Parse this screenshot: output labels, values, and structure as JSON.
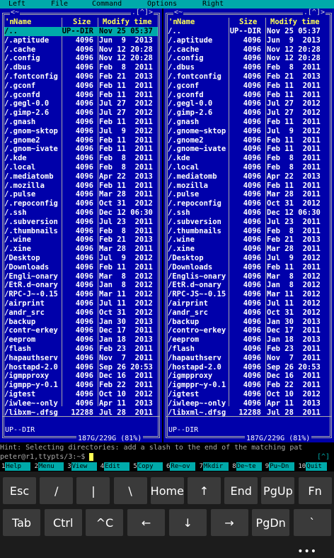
{
  "menu": {
    "left": "Left",
    "file": "File",
    "command": "Command",
    "options": "Options",
    "right": "Right"
  },
  "panel_left": {
    "top_left": "<~",
    "top_right": ".[^]>",
    "header": {
      "n": "'n",
      "name": "Name",
      "size": "Size",
      "time": "Modify time"
    },
    "rows": [
      {
        "name": "/..",
        "size": "UP--DIR",
        "time": "Nov 25 05:37",
        "sel": true
      },
      {
        "name": "/.aptitude",
        "size": "4096",
        "time": "Jun  9  2013"
      },
      {
        "name": "/.cache",
        "size": "4096",
        "time": "Nov 12 20:28"
      },
      {
        "name": "/.config",
        "size": "4096",
        "time": "Nov 12 20:28"
      },
      {
        "name": "/.dbus",
        "size": "4096",
        "time": "Feb  8  2011"
      },
      {
        "name": "/.fontconfig",
        "size": "4096",
        "time": "Feb 21  2013"
      },
      {
        "name": "/.gconf",
        "size": "4096",
        "time": "Feb 11  2011"
      },
      {
        "name": "/.gconfd",
        "size": "4096",
        "time": "Feb 11  2011"
      },
      {
        "name": "/.gegl-0.0",
        "size": "4096",
        "time": "Jul 27  2012"
      },
      {
        "name": "/.gimp-2.6",
        "size": "4096",
        "time": "Jul 27  2012"
      },
      {
        "name": "/.gnash",
        "size": "4096",
        "time": "Feb 11  2011"
      },
      {
        "name": "/.gnom~sktop",
        "size": "4096",
        "time": "Jul  9  2012"
      },
      {
        "name": "/.gnome2",
        "size": "4096",
        "time": "Feb 11  2011"
      },
      {
        "name": "/.gnom~ivate",
        "size": "4096",
        "time": "Feb 11  2011"
      },
      {
        "name": "/.kde",
        "size": "4096",
        "time": "Feb  8  2011"
      },
      {
        "name": "/.local",
        "size": "4096",
        "time": "Feb  8  2011"
      },
      {
        "name": "/.mediatomb",
        "size": "4096",
        "time": "Apr 22  2013"
      },
      {
        "name": "/.mozilla",
        "size": "4096",
        "time": "Feb 11  2011"
      },
      {
        "name": "/.pulse",
        "size": "4096",
        "time": "Mar 28  2011"
      },
      {
        "name": "/.repoconfig",
        "size": "4096",
        "time": "Oct 31  2012"
      },
      {
        "name": "/.ssh",
        "size": "4096",
        "time": "Dec 12 06:30"
      },
      {
        "name": "/.subversion",
        "size": "4096",
        "time": "Jul 23  2011"
      },
      {
        "name": "/.thumbnails",
        "size": "4096",
        "time": "Feb  8  2011"
      },
      {
        "name": "/.wine",
        "size": "4096",
        "time": "Feb 21  2013"
      },
      {
        "name": "/.xine",
        "size": "4096",
        "time": "Mar 28  2011"
      },
      {
        "name": "/Desktop",
        "size": "4096",
        "time": "Jul  9  2012"
      },
      {
        "name": "/Downloads",
        "size": "4096",
        "time": "Feb 11  2011"
      },
      {
        "name": "/Engli~onary",
        "size": "4096",
        "time": "Mar  8  2012"
      },
      {
        "name": "/EtR.d~onary",
        "size": "4096",
        "time": "Jan  8  2012"
      },
      {
        "name": "/RPC-J~-0.15",
        "size": "4096",
        "time": "Mar 11  2012"
      },
      {
        "name": "/airprint",
        "size": "4096",
        "time": "Jul 11  2012"
      },
      {
        "name": "/andr_src",
        "size": "4096",
        "time": "Oct 31  2012"
      },
      {
        "name": "/backup",
        "size": "4096",
        "time": "Jan 30  2013"
      },
      {
        "name": "/contr~erkey",
        "size": "4096",
        "time": "Dec 17  2011"
      },
      {
        "name": "/eeprom",
        "size": "4096",
        "time": "Jan 18  2013"
      },
      {
        "name": "/flash",
        "size": "4096",
        "time": "Feb 23  2011"
      },
      {
        "name": "/hapauthserv",
        "size": "4096",
        "time": "Nov  7  2011"
      },
      {
        "name": "/hostapd-2.0",
        "size": "4096",
        "time": "Sep 26 20:53"
      },
      {
        "name": "/igmpproxy",
        "size": "4096",
        "time": "Dec 16  2011"
      },
      {
        "name": "/igmpp~y-0.1",
        "size": "4096",
        "time": "Feb 22  2011"
      },
      {
        "name": "/igtest",
        "size": "4096",
        "time": "Oct 10  2012"
      },
      {
        "name": "/iwlee~-only",
        "size": "4096",
        "time": "Apr 11  2013"
      },
      {
        "name": "/libxm~.dfsg",
        "size": "12288",
        "time": "Jul 28  2011"
      }
    ],
    "mini": "UP--DIR",
    "total": "187G/229G (81%)"
  },
  "panel_right": {
    "top_left": "<~",
    "top_right": ".[^]>",
    "header": {
      "n": "'n",
      "name": "Name",
      "size": "Size",
      "time": "Modify time"
    },
    "rows": [
      {
        "name": "/..",
        "size": "UP--DIR",
        "time": "Nov 25 05:37"
      },
      {
        "name": "/.aptitude",
        "size": "4096",
        "time": "Jun  9  2013"
      },
      {
        "name": "/.cache",
        "size": "4096",
        "time": "Nov 12 20:28"
      },
      {
        "name": "/.config",
        "size": "4096",
        "time": "Nov 12 20:28"
      },
      {
        "name": "/.dbus",
        "size": "4096",
        "time": "Feb  8  2011"
      },
      {
        "name": "/.fontconfig",
        "size": "4096",
        "time": "Feb 21  2013"
      },
      {
        "name": "/.gconf",
        "size": "4096",
        "time": "Feb 11  2011"
      },
      {
        "name": "/.gconfd",
        "size": "4096",
        "time": "Feb 11  2011"
      },
      {
        "name": "/.gegl-0.0",
        "size": "4096",
        "time": "Jul 27  2012"
      },
      {
        "name": "/.gimp-2.6",
        "size": "4096",
        "time": "Jul 27  2012"
      },
      {
        "name": "/.gnash",
        "size": "4096",
        "time": "Feb 11  2011"
      },
      {
        "name": "/.gnome~sktop",
        "size": "4096",
        "time": "Jul  9  2012"
      },
      {
        "name": "/.gnome2",
        "size": "4096",
        "time": "Feb 11  2011"
      },
      {
        "name": "/.gnome~ivate",
        "size": "4096",
        "time": "Feb 11  2011"
      },
      {
        "name": "/.kde",
        "size": "4096",
        "time": "Feb  8  2011"
      },
      {
        "name": "/.local",
        "size": "4096",
        "time": "Feb  8  2011"
      },
      {
        "name": "/.mediatomb",
        "size": "4096",
        "time": "Apr 22  2013"
      },
      {
        "name": "/.mozilla",
        "size": "4096",
        "time": "Feb 11  2011"
      },
      {
        "name": "/.pulse",
        "size": "4096",
        "time": "Mar 28  2011"
      },
      {
        "name": "/.repoconfig",
        "size": "4096",
        "time": "Oct 31  2012"
      },
      {
        "name": "/.ssh",
        "size": "4096",
        "time": "Dec 12 06:30"
      },
      {
        "name": "/.subversion",
        "size": "4096",
        "time": "Jul 23  2011"
      },
      {
        "name": "/.thumbnails",
        "size": "4096",
        "time": "Feb  8  2011"
      },
      {
        "name": "/.wine",
        "size": "4096",
        "time": "Feb 21  2013"
      },
      {
        "name": "/.xine",
        "size": "4096",
        "time": "Mar 28  2011"
      },
      {
        "name": "/Desktop",
        "size": "4096",
        "time": "Jul  9  2012"
      },
      {
        "name": "/Downloads",
        "size": "4096",
        "time": "Feb 11  2011"
      },
      {
        "name": "/Englis~onary",
        "size": "4096",
        "time": "Mar  8  2012"
      },
      {
        "name": "/EtR.d~onary",
        "size": "4096",
        "time": "Jan  8  2012"
      },
      {
        "name": "/RPC-JS~-0.15",
        "size": "4096",
        "time": "Mar 11  2012"
      },
      {
        "name": "/airprint",
        "size": "4096",
        "time": "Jul 11  2012"
      },
      {
        "name": "/andr_src",
        "size": "4096",
        "time": "Oct 31  2012"
      },
      {
        "name": "/backup",
        "size": "4096",
        "time": "Jan 30  2013"
      },
      {
        "name": "/contro~erkey",
        "size": "4096",
        "time": "Dec 17  2011"
      },
      {
        "name": "/eeprom",
        "size": "4096",
        "time": "Jan 18  2013"
      },
      {
        "name": "/flash",
        "size": "4096",
        "time": "Feb 23  2011"
      },
      {
        "name": "/hapauthserv",
        "size": "4096",
        "time": "Nov  7  2011"
      },
      {
        "name": "/hostapd-2.0",
        "size": "4096",
        "time": "Sep 26 20:53"
      },
      {
        "name": "/igmpproxy",
        "size": "4096",
        "time": "Dec 16  2011"
      },
      {
        "name": "/igmppr~y-0.1",
        "size": "4096",
        "time": "Feb 22  2011"
      },
      {
        "name": "/igtest",
        "size": "4096",
        "time": "Oct 10  2012"
      },
      {
        "name": "/iwleep~-only",
        "size": "4096",
        "time": "Apr 11  2013"
      },
      {
        "name": "/libxml~.dfsg",
        "size": "12288",
        "time": "Jul 28  2011"
      }
    ],
    "mini": "UP--DIR",
    "total": "187G/229G (81%)"
  },
  "hint": "Hint: Selecting directories: add a slash to the end of the matching pat",
  "prompt": "peter@r1,ttypts/3:~$ ",
  "prompt_right": "[^]",
  "fkeys": [
    {
      "n": "1",
      "l": "Help"
    },
    {
      "n": "2",
      "l": "Menu"
    },
    {
      "n": "3",
      "l": "View"
    },
    {
      "n": "4",
      "l": "Edit"
    },
    {
      "n": "5",
      "l": "Copy"
    },
    {
      "n": "6",
      "l": "Re~ov"
    },
    {
      "n": "7",
      "l": "Mkdir"
    },
    {
      "n": "8",
      "l": "De~te"
    },
    {
      "n": "9",
      "l": "Pu~Dn"
    },
    {
      "n": "10",
      "l": "Quit"
    }
  ],
  "keys_row1": [
    "Esc",
    "/",
    "|",
    "\\",
    "Home",
    "↑",
    "End",
    "PgUp",
    "Fn"
  ],
  "keys_row2": [
    "Tab",
    "Ctrl",
    "^C",
    "←",
    "↓",
    "→",
    "PgDn",
    "`"
  ],
  "more_label": "•••",
  "colors": {
    "panel": "#0000aa",
    "accent": "#00aaaa",
    "header": "#ffff55",
    "key": "#3a3a3a"
  }
}
